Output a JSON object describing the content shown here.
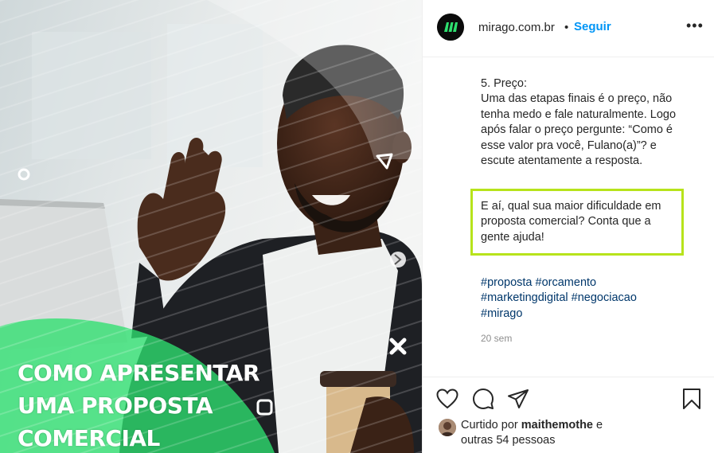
{
  "post_image": {
    "title_lines": [
      "COMO APRESENTAR",
      "UMA PROPOSTA",
      "COMERCIAL"
    ]
  },
  "header": {
    "username": "mirago.com.br",
    "separator": "•",
    "follow_label": "Seguir",
    "more_label": "•••"
  },
  "caption": {
    "lines": [
      "5. Preço:",
      "Uma das etapas finais é o preço, não",
      "tenha medo e fale naturalmente. Logo",
      "após falar o preço pergunte: “Como é",
      "esse valor pra você, Fulano(a)”? e",
      "escute atentamente a resposta."
    ],
    "highlight_lines": [
      "E aí, qual sua maior dificuldade em",
      "proposta comercial? Conta que a",
      "gente ajuda!"
    ],
    "hashtags": [
      "#proposta",
      "#orcamento",
      "#marketingdigital",
      "#negociacao",
      "#mirago"
    ],
    "age": "20 sem"
  },
  "likes": {
    "prefix": "Curtido por",
    "user": "maithemothe",
    "conjunction": "e",
    "others": "outras 54 pessoas"
  },
  "colors": {
    "brand_green": "#2ee06f",
    "highlight_border": "#b7e31b",
    "follow_blue": "#0095f6",
    "hashtag_blue": "#00376b"
  }
}
